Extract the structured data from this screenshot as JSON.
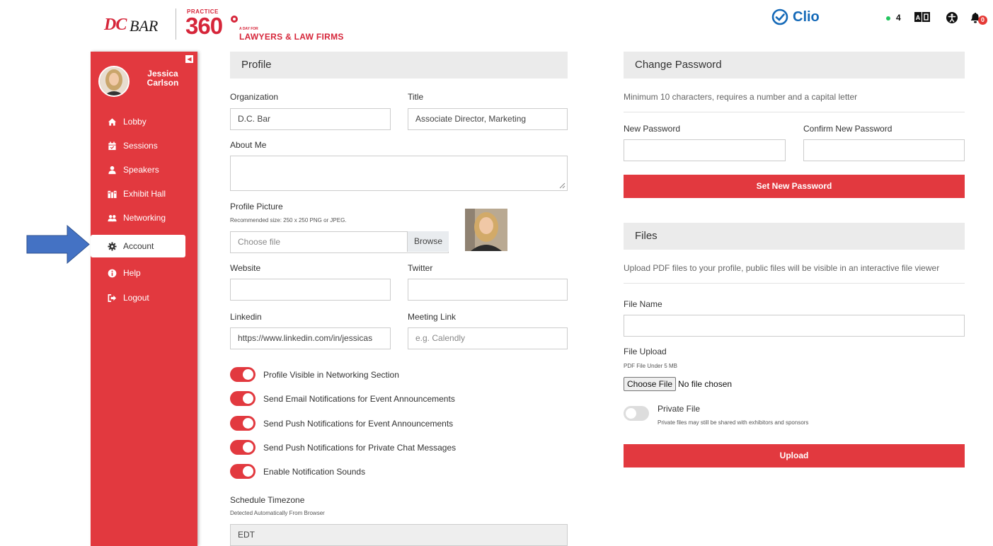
{
  "header": {
    "dcbar_logo_dc": "DC",
    "dcbar_logo_bar": "BAR",
    "practice_label": "PRACTICE",
    "practice_number": "360",
    "practice_aday": "A DAY FOR",
    "practice_tagline": "LAWYERS & LAW FIRMS",
    "sponsor_name": "Clio",
    "online_count": "4",
    "notification_count": "0",
    "icons": [
      "translate-icon",
      "accessibility-icon",
      "bell-icon"
    ]
  },
  "sidebar": {
    "user_name": "Jessica Carlson",
    "items": [
      {
        "label": "Lobby",
        "icon": "home-icon"
      },
      {
        "label": "Sessions",
        "icon": "calendar-icon"
      },
      {
        "label": "Speakers",
        "icon": "user-icon"
      },
      {
        "label": "Exhibit Hall",
        "icon": "exhibit-icon"
      },
      {
        "label": "Networking",
        "icon": "users-icon"
      },
      {
        "label": "Account",
        "icon": "gear-icon",
        "active": true
      },
      {
        "label": "Help",
        "icon": "info-icon"
      },
      {
        "label": "Logout",
        "icon": "logout-icon"
      }
    ]
  },
  "profile": {
    "title": "Profile",
    "organization_label": "Organization",
    "organization_value": "D.C. Bar",
    "title_label": "Title",
    "title_value": "Associate Director, Marketing",
    "about_label": "About Me",
    "about_value": "",
    "picture_label": "Profile Picture",
    "picture_hint": "Recommended size: 250 x 250 PNG or JPEG.",
    "choose_file_label": "Choose file",
    "browse_label": "Browse",
    "website_label": "Website",
    "website_value": "",
    "twitter_label": "Twitter",
    "twitter_value": "",
    "linkedin_label": "Linkedin",
    "linkedin_value": "https://www.linkedin.com/in/jessicas",
    "meeting_label": "Meeting Link",
    "meeting_placeholder": "e.g. Calendly",
    "toggles": [
      {
        "label": "Profile Visible in Networking Section",
        "on": true
      },
      {
        "label": "Send Email Notifications for Event Announcements",
        "on": true
      },
      {
        "label": "Send Push Notifications for Event Announcements",
        "on": true
      },
      {
        "label": "Send Push Notifications for Private Chat Messages",
        "on": true
      },
      {
        "label": "Enable Notification Sounds",
        "on": true
      }
    ],
    "timezone_label": "Schedule Timezone",
    "timezone_hint": "Detected Automatically From Browser",
    "timezone_value": "EDT"
  },
  "password": {
    "title": "Change Password",
    "hint": "Minimum 10 characters, requires a number and a capital letter",
    "new_label": "New Password",
    "confirm_label": "Confirm New Password",
    "button_label": "Set New Password"
  },
  "files": {
    "title": "Files",
    "hint": "Upload PDF files to your profile, public files will be visible in an interactive file viewer",
    "name_label": "File Name",
    "upload_label": "File Upload",
    "upload_hint": "PDF File Under 5 MB",
    "choose_file_button": "Choose File",
    "no_file_text": "No file chosen",
    "private_label": "Private File",
    "private_hint": "Private files may still be shared with exhibitors and sponsors",
    "private_on": false,
    "upload_button": "Upload"
  },
  "colors": {
    "accent": "#e2393f",
    "sidebar": "#e2393f",
    "section_header": "#ebebeb",
    "arrow": "#4472c4",
    "clio_blue": "#1469b8"
  }
}
